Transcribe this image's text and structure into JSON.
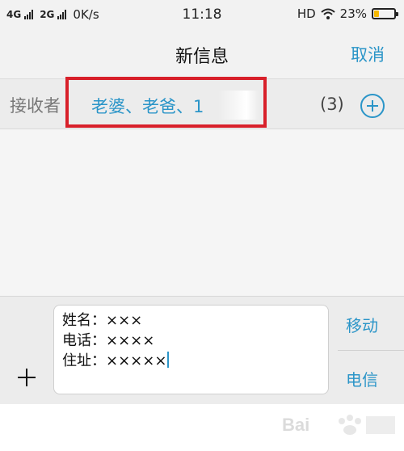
{
  "status_bar": {
    "net1": "4G",
    "net2": "2G",
    "speed": "0K/s",
    "time": "11:18",
    "hd": "HD",
    "battery_text": "23%",
    "battery_level": 0.23,
    "battery_color": "#f5b800"
  },
  "header": {
    "title": "新信息",
    "cancel_label": "取消"
  },
  "recipients": {
    "label": "接收者",
    "names": "老婆、老爸、1",
    "count": "(3)",
    "highlight_color": "#d8202a",
    "accent_color": "#2b95c8"
  },
  "compose": {
    "lines": [
      "姓名：×××",
      "电话：××××",
      "住址：×××××"
    ],
    "sim_buttons": [
      "移动",
      "电信"
    ]
  },
  "watermark": {
    "icon": "baidu-paw-icon",
    "text": "Bai"
  }
}
